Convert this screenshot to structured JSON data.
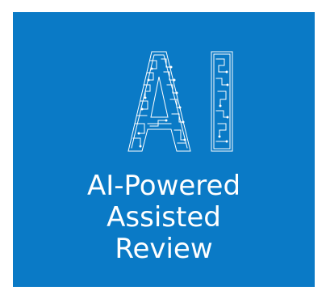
{
  "tile": {
    "background": "#0a7ac6",
    "logo_text": "AI",
    "caption_lines": [
      "AI-Powered",
      "Assisted",
      "Review"
    ]
  }
}
